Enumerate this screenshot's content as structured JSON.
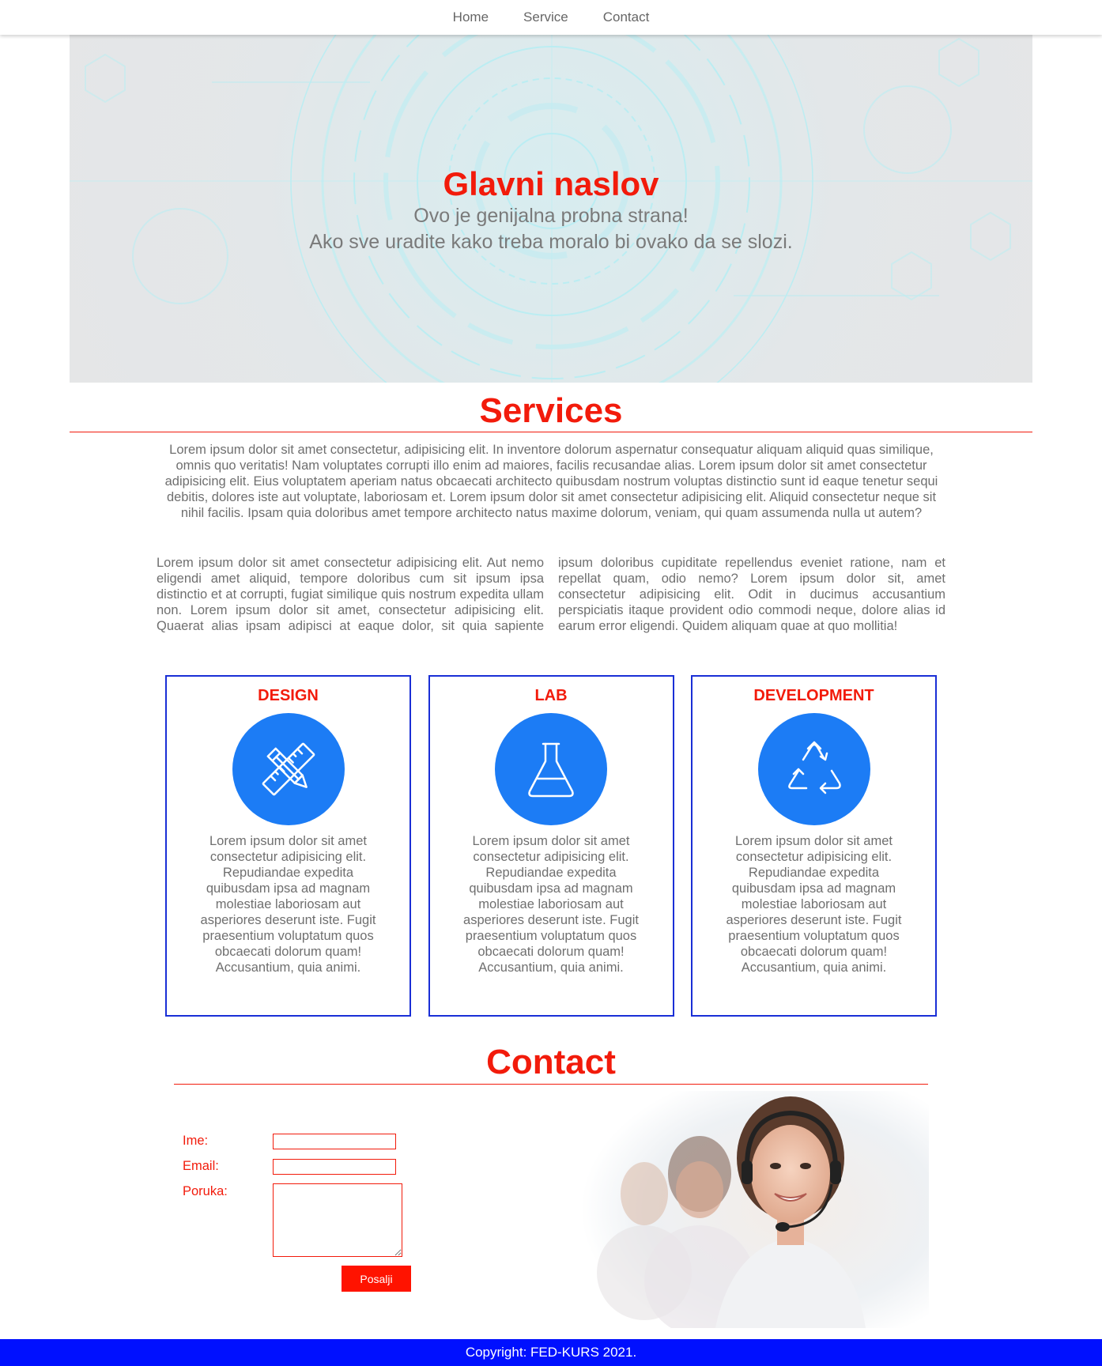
{
  "nav": {
    "items": [
      "Home",
      "Service",
      "Contact"
    ]
  },
  "hero": {
    "title": "Glavni naslov",
    "line1": "Ovo je genijalna probna strana!",
    "line2": "Ako sve uradite kako treba moralo bi ovako da se slozi."
  },
  "services": {
    "title": "Services",
    "intro": "Lorem ipsum dolor sit amet consectetur, adipisicing elit. In inventore dolorum aspernatur consequatur aliquam aliquid quas similique, omnis quo veritatis! Nam voluptates corrupti illo enim ad maiores, facilis recusandae alias. Lorem ipsum dolor sit amet consectetur adipisicing elit. Eius voluptatem aperiam natus obcaecati architecto quibusdam nostrum voluptas distinctio sunt id eaque tenetur sequi debitis, dolores iste aut voluptate, laboriosam et. Lorem ipsum dolor sit amet consectetur adipisicing elit. Aliquid consectetur neque sit nihil facilis. Ipsam quia doloribus amet tempore architecto natus maxime dolorum, veniam, qui quam assumenda nulla ut autem?",
    "columns_text": "Lorem ipsum dolor sit amet consectetur adipisicing elit. Aut nemo eligendi amet aliquid, tempore doloribus cum sit ipsum ipsa distinctio et at corrupti, fugiat similique quis nostrum expedita ullam non. Lorem ipsum dolor sit amet, consectetur adipisicing elit. Quaerat alias ipsam adipisci at eaque dolor, sit quia sapiente ipsum doloribus cupiditate repellendus eveniet ratione, nam et repellat quam, odio nemo? Lorem ipsum dolor sit, amet consectetur adipisicing elit. Odit in ducimus accusantium perspiciatis itaque provident odio commodi neque, dolore alias id earum error eligendi. Quidem aliquam quae at quo mollitia!",
    "cards": [
      {
        "title": "DESIGN",
        "icon": "pencil-ruler-icon",
        "text": "Lorem ipsum dolor sit amet consectetur adipisicing elit. Repudiandae expedita quibusdam ipsa ad magnam molestiae laboriosam aut asperiores deserunt iste. Fugit praesentium voluptatum quos obcaecati dolorum quam! Accusantium, quia animi."
      },
      {
        "title": "LAB",
        "icon": "flask-icon",
        "text": "Lorem ipsum dolor sit amet consectetur adipisicing elit. Repudiandae expedita quibusdam ipsa ad magnam molestiae laboriosam aut asperiores deserunt iste. Fugit praesentium voluptatum quos obcaecati dolorum quam! Accusantium, quia animi."
      },
      {
        "title": "DEVELOPMENT",
        "icon": "recycle-icon",
        "text": "Lorem ipsum dolor sit amet consectetur adipisicing elit. Repudiandae expedita quibusdam ipsa ad magnam molestiae laboriosam aut asperiores deserunt iste. Fugit praesentium voluptatum quos obcaecati dolorum quam! Accusantium, quia animi."
      }
    ]
  },
  "contact": {
    "title": "Contact",
    "labels": {
      "name": "Ime:",
      "email": "Email:",
      "message": "Poruka:"
    },
    "values": {
      "name": "",
      "email": "",
      "message": ""
    },
    "submit": "Posalji"
  },
  "footer": {
    "text": "Copyright: FED-KURS 2021."
  },
  "colors": {
    "accent_red": "#f21b0b",
    "card_border": "#1a2fd6",
    "icon_circle": "#1c7cf5",
    "footer_bg": "#0010ff"
  }
}
